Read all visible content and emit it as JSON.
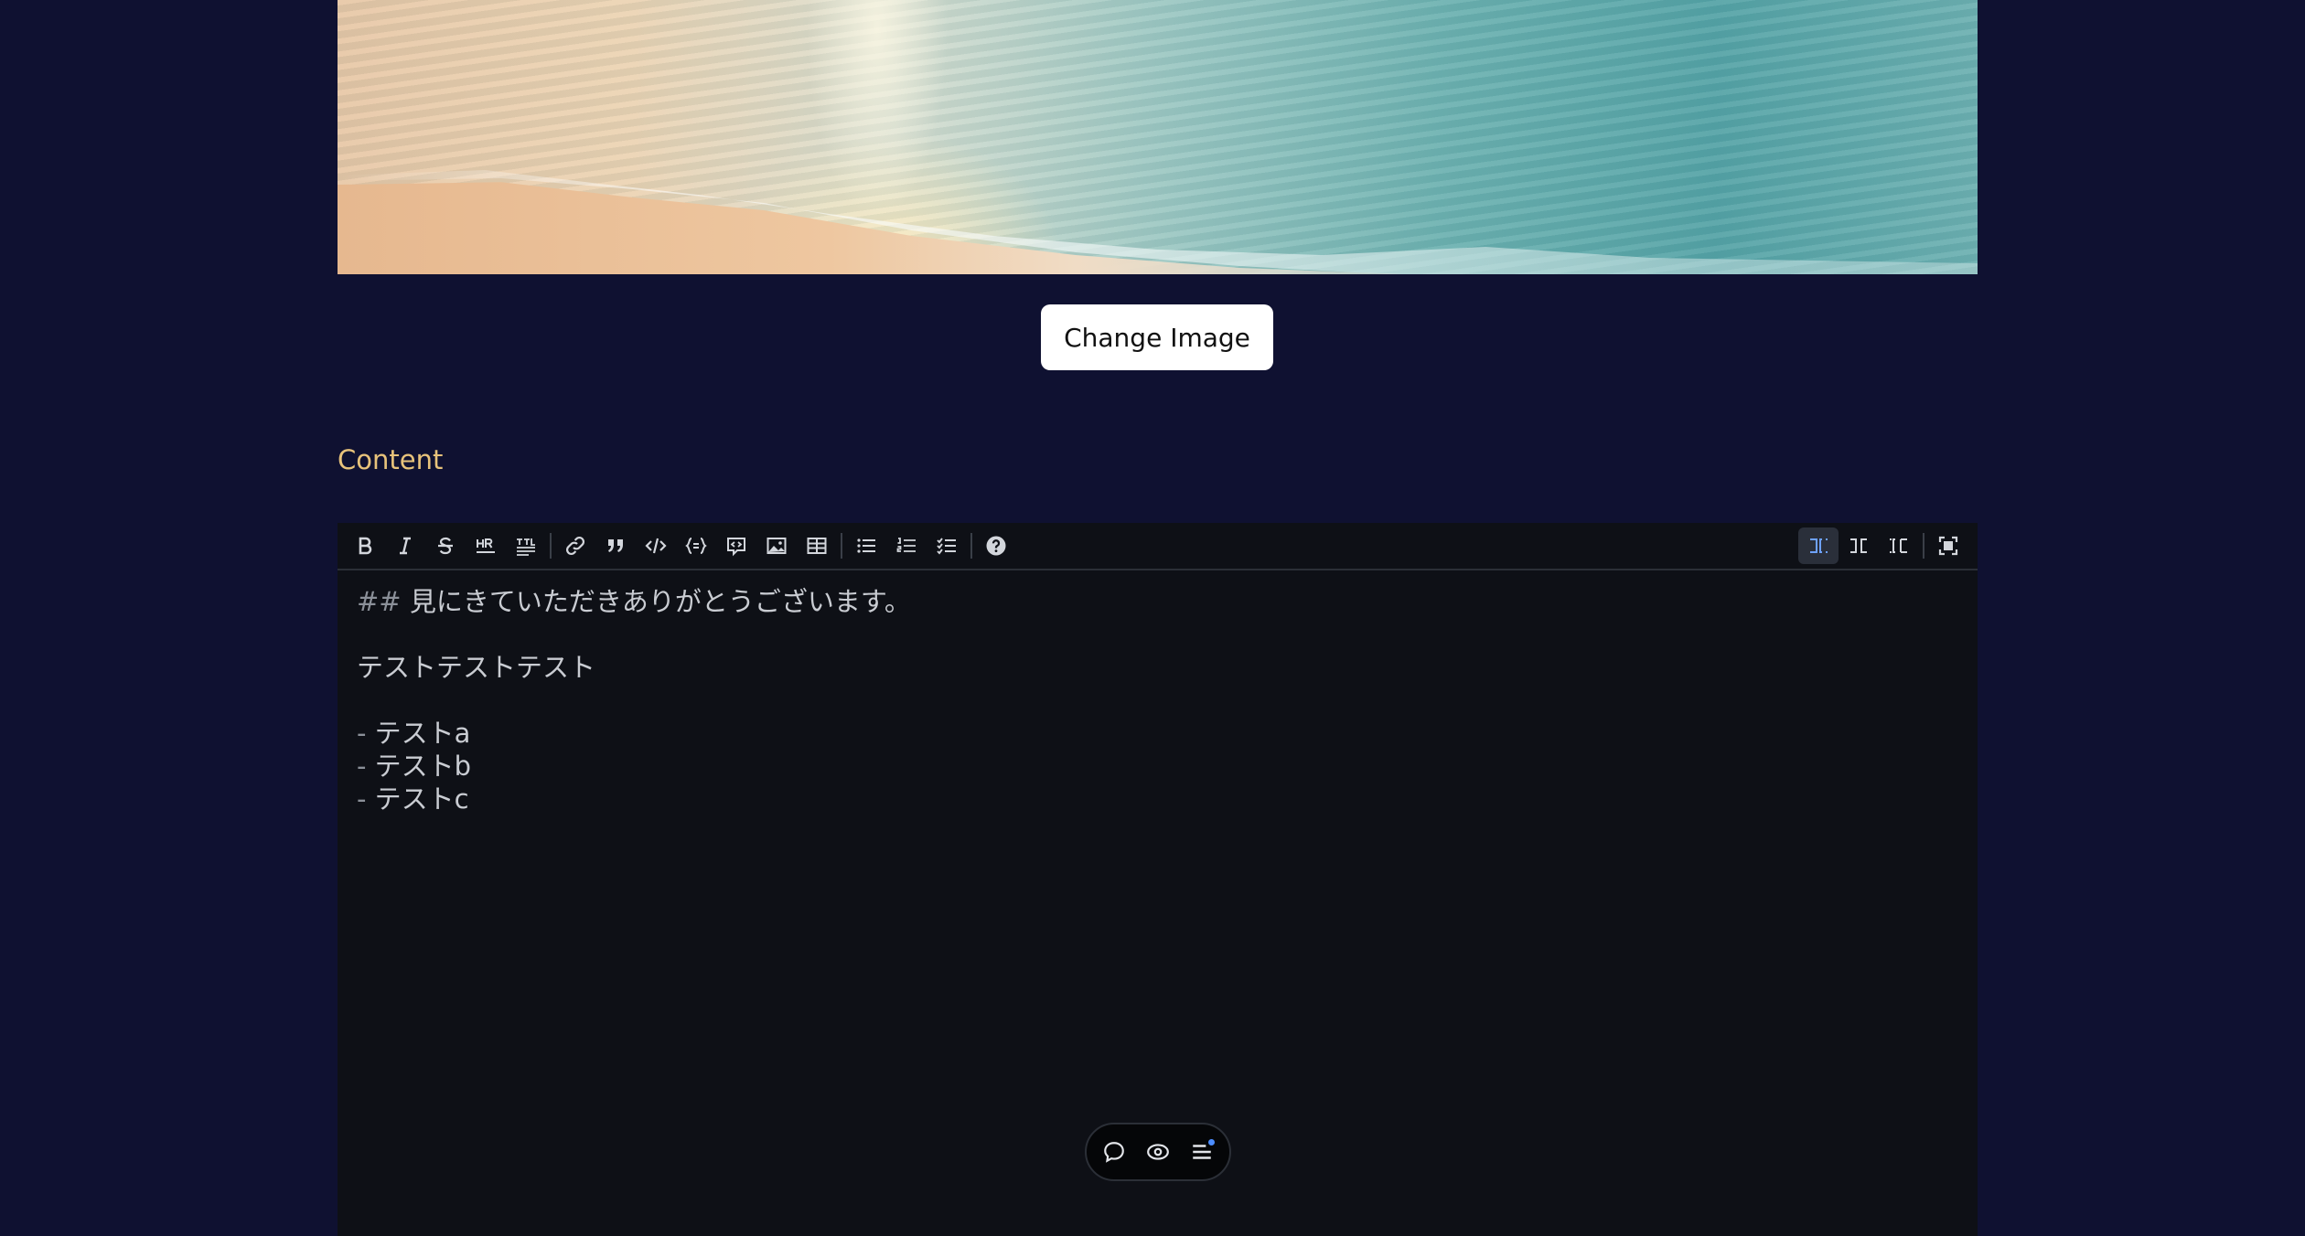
{
  "hero": {
    "alt": "beach"
  },
  "change_image": {
    "label": "Change Image"
  },
  "section": {
    "label": "Content"
  },
  "editor": {
    "toolbar": {
      "groups": [
        [
          "bold-icon",
          "italic-icon",
          "strikethrough-icon",
          "hr-icon",
          "title-icon"
        ],
        [
          "link-icon",
          "quote-icon",
          "code-icon",
          "code-block-icon",
          "comment-icon",
          "image-icon",
          "table-icon"
        ],
        [
          "unordered-list-icon",
          "ordered-list-icon",
          "checklist-icon"
        ],
        [
          "help-icon"
        ]
      ],
      "right": [
        "editor-only-icon",
        "split-view-icon",
        "preview-only-icon",
        "fullscreen-icon"
      ],
      "active_view": "editor-only-icon",
      "active_color": "#6ea1ff"
    },
    "lines": {
      "l1_mark": "##",
      "l1_text": " 見にきていただきありがとうございます。",
      "l3": "テストテストテスト",
      "l5_mark": "-",
      "l5_text": " テストa",
      "l6_mark": "-",
      "l6_text": " テストb",
      "l7_mark": "-",
      "l7_text": " テストc"
    }
  },
  "float_bar": {
    "items": [
      "comment-icon",
      "preview-icon",
      "outline-icon"
    ],
    "dot_color": "#4c8dff"
  },
  "colors": {
    "background": "#0f1131",
    "label": "#e8c37b",
    "editor_bg": "#0e1016"
  }
}
